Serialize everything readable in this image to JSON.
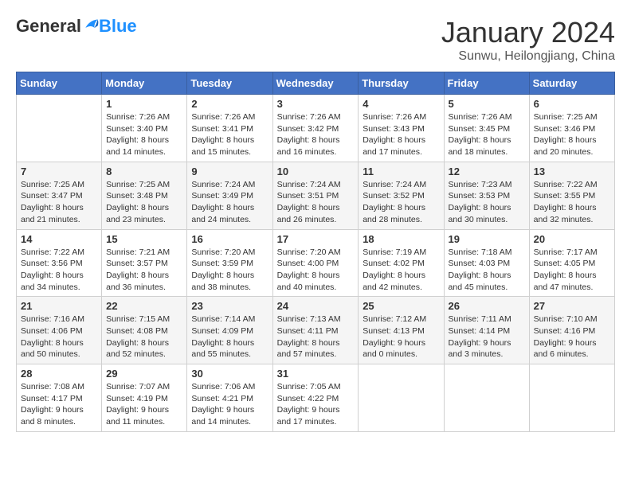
{
  "logo": {
    "general": "General",
    "blue": "Blue"
  },
  "header": {
    "month_year": "January 2024",
    "location": "Sunwu, Heilongjiang, China"
  },
  "weekdays": [
    "Sunday",
    "Monday",
    "Tuesday",
    "Wednesday",
    "Thursday",
    "Friday",
    "Saturday"
  ],
  "weeks": [
    [
      {
        "day": null,
        "info": null
      },
      {
        "day": "1",
        "info": "Sunrise: 7:26 AM\nSunset: 3:40 PM\nDaylight: 8 hours\nand 14 minutes."
      },
      {
        "day": "2",
        "info": "Sunrise: 7:26 AM\nSunset: 3:41 PM\nDaylight: 8 hours\nand 15 minutes."
      },
      {
        "day": "3",
        "info": "Sunrise: 7:26 AM\nSunset: 3:42 PM\nDaylight: 8 hours\nand 16 minutes."
      },
      {
        "day": "4",
        "info": "Sunrise: 7:26 AM\nSunset: 3:43 PM\nDaylight: 8 hours\nand 17 minutes."
      },
      {
        "day": "5",
        "info": "Sunrise: 7:26 AM\nSunset: 3:45 PM\nDaylight: 8 hours\nand 18 minutes."
      },
      {
        "day": "6",
        "info": "Sunrise: 7:25 AM\nSunset: 3:46 PM\nDaylight: 8 hours\nand 20 minutes."
      }
    ],
    [
      {
        "day": "7",
        "info": "Sunrise: 7:25 AM\nSunset: 3:47 PM\nDaylight: 8 hours\nand 21 minutes."
      },
      {
        "day": "8",
        "info": "Sunrise: 7:25 AM\nSunset: 3:48 PM\nDaylight: 8 hours\nand 23 minutes."
      },
      {
        "day": "9",
        "info": "Sunrise: 7:24 AM\nSunset: 3:49 PM\nDaylight: 8 hours\nand 24 minutes."
      },
      {
        "day": "10",
        "info": "Sunrise: 7:24 AM\nSunset: 3:51 PM\nDaylight: 8 hours\nand 26 minutes."
      },
      {
        "day": "11",
        "info": "Sunrise: 7:24 AM\nSunset: 3:52 PM\nDaylight: 8 hours\nand 28 minutes."
      },
      {
        "day": "12",
        "info": "Sunrise: 7:23 AM\nSunset: 3:53 PM\nDaylight: 8 hours\nand 30 minutes."
      },
      {
        "day": "13",
        "info": "Sunrise: 7:22 AM\nSunset: 3:55 PM\nDaylight: 8 hours\nand 32 minutes."
      }
    ],
    [
      {
        "day": "14",
        "info": "Sunrise: 7:22 AM\nSunset: 3:56 PM\nDaylight: 8 hours\nand 34 minutes."
      },
      {
        "day": "15",
        "info": "Sunrise: 7:21 AM\nSunset: 3:57 PM\nDaylight: 8 hours\nand 36 minutes."
      },
      {
        "day": "16",
        "info": "Sunrise: 7:20 AM\nSunset: 3:59 PM\nDaylight: 8 hours\nand 38 minutes."
      },
      {
        "day": "17",
        "info": "Sunrise: 7:20 AM\nSunset: 4:00 PM\nDaylight: 8 hours\nand 40 minutes."
      },
      {
        "day": "18",
        "info": "Sunrise: 7:19 AM\nSunset: 4:02 PM\nDaylight: 8 hours\nand 42 minutes."
      },
      {
        "day": "19",
        "info": "Sunrise: 7:18 AM\nSunset: 4:03 PM\nDaylight: 8 hours\nand 45 minutes."
      },
      {
        "day": "20",
        "info": "Sunrise: 7:17 AM\nSunset: 4:05 PM\nDaylight: 8 hours\nand 47 minutes."
      }
    ],
    [
      {
        "day": "21",
        "info": "Sunrise: 7:16 AM\nSunset: 4:06 PM\nDaylight: 8 hours\nand 50 minutes."
      },
      {
        "day": "22",
        "info": "Sunrise: 7:15 AM\nSunset: 4:08 PM\nDaylight: 8 hours\nand 52 minutes."
      },
      {
        "day": "23",
        "info": "Sunrise: 7:14 AM\nSunset: 4:09 PM\nDaylight: 8 hours\nand 55 minutes."
      },
      {
        "day": "24",
        "info": "Sunrise: 7:13 AM\nSunset: 4:11 PM\nDaylight: 8 hours\nand 57 minutes."
      },
      {
        "day": "25",
        "info": "Sunrise: 7:12 AM\nSunset: 4:13 PM\nDaylight: 9 hours\nand 0 minutes."
      },
      {
        "day": "26",
        "info": "Sunrise: 7:11 AM\nSunset: 4:14 PM\nDaylight: 9 hours\nand 3 minutes."
      },
      {
        "day": "27",
        "info": "Sunrise: 7:10 AM\nSunset: 4:16 PM\nDaylight: 9 hours\nand 6 minutes."
      }
    ],
    [
      {
        "day": "28",
        "info": "Sunrise: 7:08 AM\nSunset: 4:17 PM\nDaylight: 9 hours\nand 8 minutes."
      },
      {
        "day": "29",
        "info": "Sunrise: 7:07 AM\nSunset: 4:19 PM\nDaylight: 9 hours\nand 11 minutes."
      },
      {
        "day": "30",
        "info": "Sunrise: 7:06 AM\nSunset: 4:21 PM\nDaylight: 9 hours\nand 14 minutes."
      },
      {
        "day": "31",
        "info": "Sunrise: 7:05 AM\nSunset: 4:22 PM\nDaylight: 9 hours\nand 17 minutes."
      },
      {
        "day": null,
        "info": null
      },
      {
        "day": null,
        "info": null
      },
      {
        "day": null,
        "info": null
      }
    ]
  ]
}
